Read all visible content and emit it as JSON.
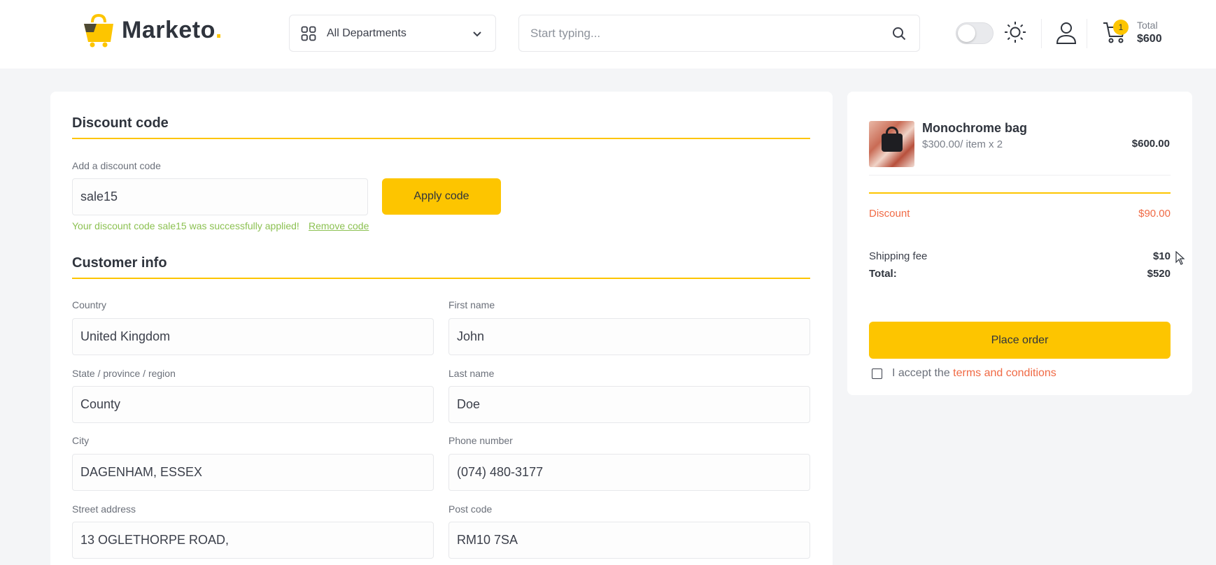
{
  "header": {
    "logo_text": "Marketo",
    "logo_dot": ".",
    "departments_label": "All Departments",
    "search_placeholder": "Start typing...",
    "cart_count": "1",
    "cart_total_label": "Total",
    "cart_total_value": "$600"
  },
  "discount": {
    "title": "Discount code",
    "label": "Add a discount code",
    "value": "sale15",
    "apply_label": "Apply code",
    "success_message": "Your discount code sale15 was successfully applied!",
    "remove_label": "Remove code"
  },
  "customer": {
    "title": "Customer info",
    "fields": {
      "country": {
        "label": "Country",
        "value": "United Kingdom"
      },
      "first_name": {
        "label": "First name",
        "value": "John"
      },
      "state": {
        "label": "State / province / region",
        "value": "County"
      },
      "last_name": {
        "label": "Last name",
        "value": "Doe"
      },
      "city": {
        "label": "City",
        "value": "DAGENHAM, ESSEX"
      },
      "phone": {
        "label": "Phone number",
        "value": "(074) 480-3177"
      },
      "street": {
        "label": "Street address",
        "value": "13 OGLETHORPE ROAD,"
      },
      "post_code": {
        "label": "Post code",
        "value": "RM10 7SA"
      }
    }
  },
  "summary": {
    "product_name": "Monochrome bag",
    "product_unit": "$300.00/ item x 2",
    "product_price": "$600.00",
    "discount_label": "Discount",
    "discount_value": "$90.00",
    "shipping_label": "Shipping fee",
    "shipping_value": "$10",
    "total_label": "Total:",
    "total_value": "$520",
    "place_order_label": "Place order",
    "accept_prefix": "I accept the",
    "terms_label": "terms and conditions"
  },
  "colors": {
    "accent": "#fdc500",
    "success": "#8cc152",
    "discount": "#f06a45",
    "background": "#f4f5f7"
  }
}
